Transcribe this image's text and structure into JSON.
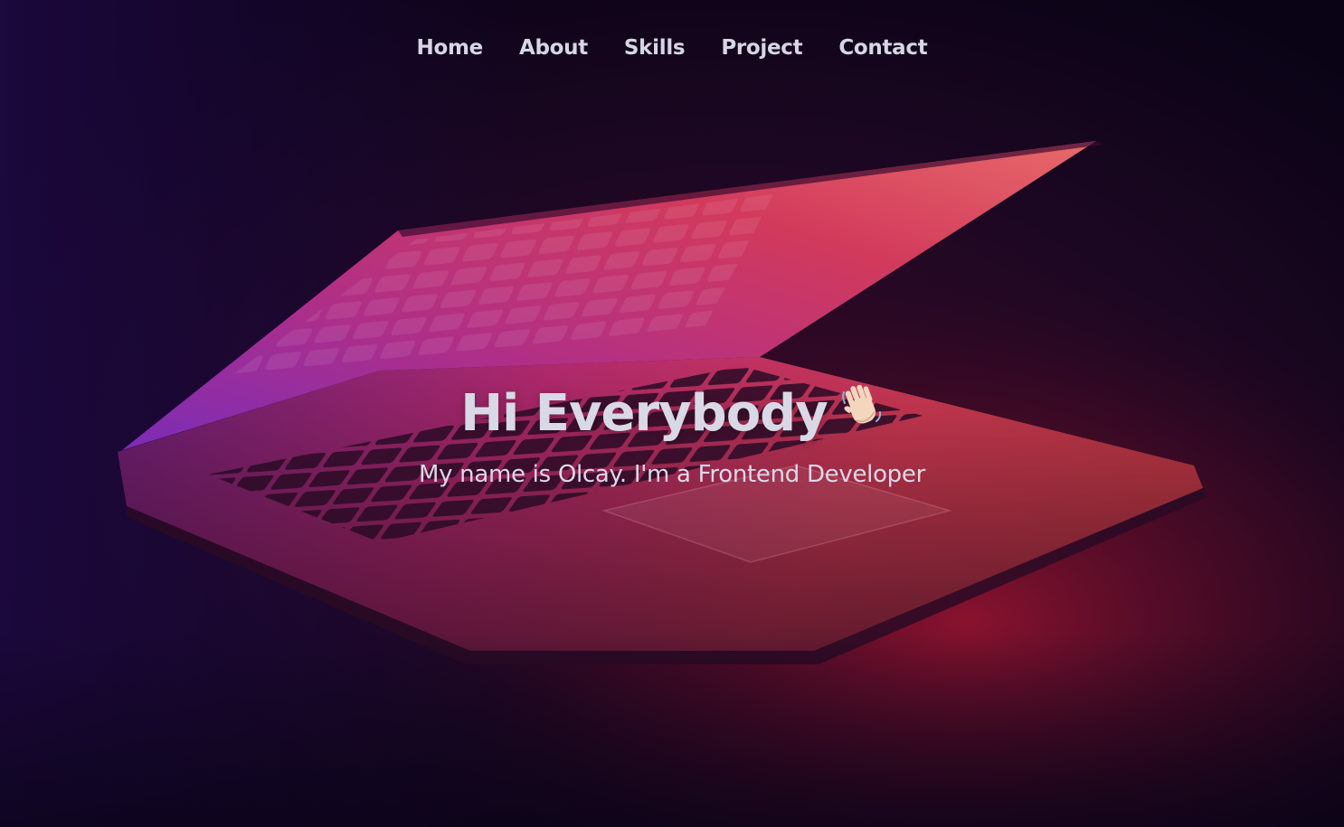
{
  "nav": {
    "items": [
      {
        "label": "Home"
      },
      {
        "label": "About"
      },
      {
        "label": "Skills"
      },
      {
        "label": "Project"
      },
      {
        "label": "Contact"
      }
    ]
  },
  "hero": {
    "title": "Hi Everybody",
    "subtitle": "My name is Olcay. I'm a Frontend Developer",
    "title_icon": "waving-hand-icon",
    "background_image": "laptop-photo"
  },
  "colors": {
    "background_dark": "#0b0418",
    "laptop_glow_magenta": "#c8346a",
    "laptop_glow_purple": "#7a2ab0",
    "text_light": "#d9d8e6"
  }
}
